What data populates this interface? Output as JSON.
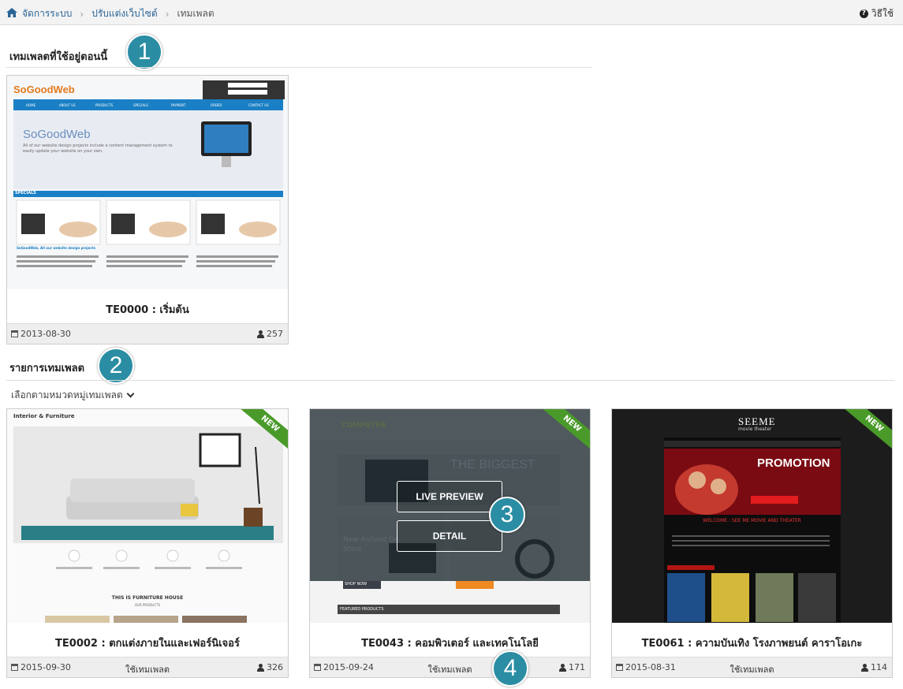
{
  "breadcrumb": {
    "home": "จัดการระบบ",
    "customize": "ปรับแต่งเว็บไซต์",
    "current": "เทมเพลต"
  },
  "help": {
    "label": "วิธีใช้"
  },
  "current_section": {
    "title": "เทมเพลตที่ใช้อยู่ตอนนี้",
    "badge": "1"
  },
  "current_template": {
    "name": "TE0000 : เริ่มต้น",
    "date": "2013-08-30",
    "views": "257",
    "preview": {
      "logo": "SoGoodWeb",
      "nav": [
        "HOME",
        "ABOUT US",
        "PRODUCTS",
        "SPECIALS",
        "PAYMENT",
        "ORDER",
        "CONTACT US"
      ],
      "hero_title": "SoGoodWeb",
      "hero_text": "All of our website design projects include a content management system to easily update your website on your own.",
      "specials_label": "SPECIALS",
      "item_title": "SoGoodWeb, All our website design projects"
    }
  },
  "list_section": {
    "title": "รายการเทมเพลต",
    "badge": "2",
    "filter_label": "เลือกตามหมวดหมู่เทมเพลต"
  },
  "templates": [
    {
      "name": "TE0002 : ตกแต่งภายในและเฟอร์นิเจอร์",
      "date": "2015-09-30",
      "use_label": "ใช้เทมเพลต",
      "views": "326",
      "ribbon": "NEW",
      "preview": {
        "brand": "Interior & Furniture",
        "heading": "THIS IS FURNITURE HOUSE",
        "sub": "OUR PRODUCTS"
      }
    },
    {
      "name": "TE0043 : คอมพิวเตอร์ และเทคโนโลยี",
      "date": "2015-09-24",
      "use_label": "ใช้เทมเพลต",
      "views": "171",
      "ribbon": "NEW",
      "overlay": {
        "preview_label": "LIVE PREVIEW",
        "detail_label": "DETAIL",
        "badge": "3"
      },
      "preview": {
        "brand": "COMPUTER",
        "big": "THE BIGGEST",
        "arrived": "New Arrived On Store",
        "shop": "SHOP NOW",
        "featured": "FEATURED PRODUCTS"
      }
    },
    {
      "name": "TE0061 : ความบันเทิง โรงภาพยนต์ คาราโอเกะ",
      "date": "2015-08-31",
      "use_label": "ใช้เทมเพลต",
      "views": "114",
      "ribbon": "NEW",
      "preview": {
        "brand": "SEEME",
        "brand_sub": "movie theater",
        "promo": "PROMOTION",
        "welcome": "WELCOME : SEE ME MOVIE AND THEATER"
      }
    }
  ],
  "footer_badge": "4"
}
